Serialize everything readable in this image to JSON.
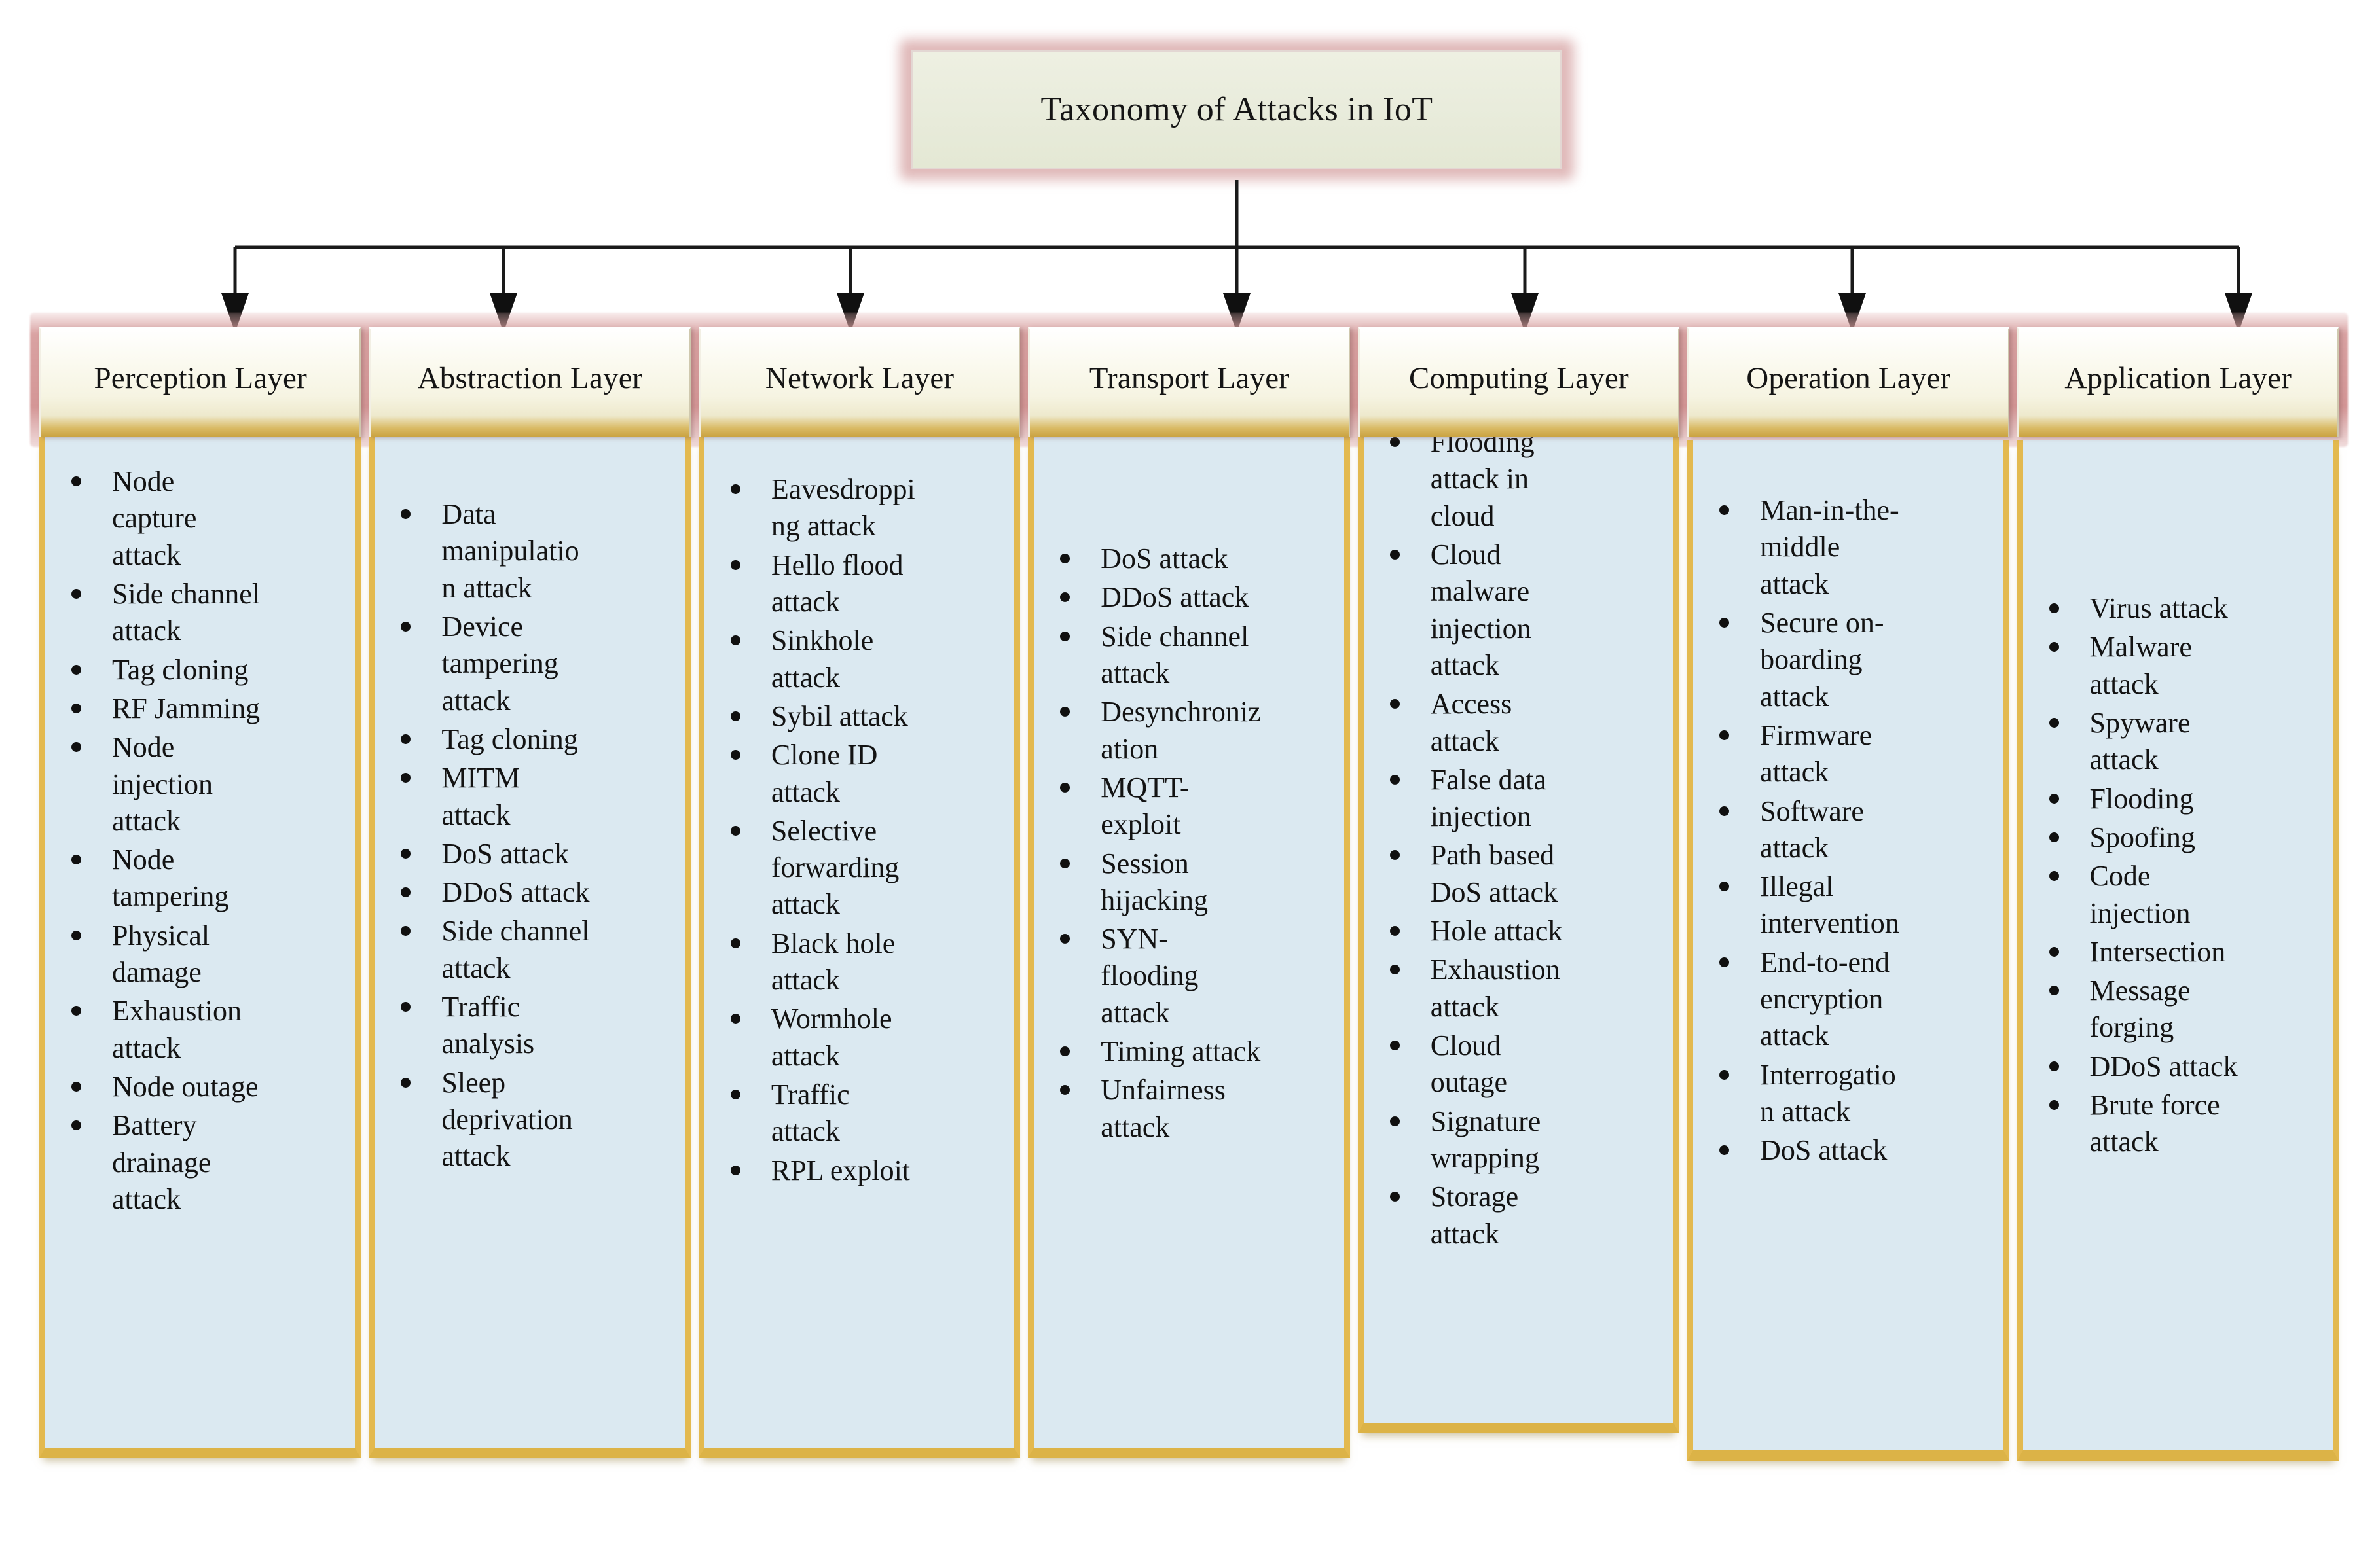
{
  "root": {
    "title": "Taxonomy of Attacks in IoT"
  },
  "colors": {
    "root_fill": "#e9ecdc",
    "root_border": "#e3d7d3",
    "header_band": "#d79d9d",
    "header_fill": "#f6f4e2",
    "header_gold_edge": "#c9a13f",
    "body_fill": "#dbe9f1",
    "body_border_gold": "#e3b94f",
    "text": "#131313",
    "connector": "#1a1a1a"
  },
  "connector": {
    "icon": "down-arrow-icon",
    "count": 7
  },
  "layers": [
    {
      "title": "Perception Layer",
      "attacks": [
        [
          "Node",
          "capture",
          "attack"
        ],
        [
          "Side channel",
          "attack"
        ],
        [
          "Tag cloning"
        ],
        [
          "RF Jamming"
        ],
        [
          "Node",
          "injection",
          "attack"
        ],
        [
          "Node",
          "tampering"
        ],
        [
          "Physical",
          "damage"
        ],
        [
          "Exhaustion",
          "attack"
        ],
        [
          "Node outage"
        ],
        [
          "Battery",
          "drainage",
          "attack"
        ]
      ]
    },
    {
      "title": "Abstraction Layer",
      "attacks": [
        [
          "Data",
          "manipulatio",
          "n attack"
        ],
        [
          "Device",
          "tampering",
          "attack"
        ],
        [
          "Tag cloning"
        ],
        [
          "MITM",
          "attack"
        ],
        [
          "DoS attack"
        ],
        [
          "DDoS attack"
        ],
        [
          "Side channel",
          "attack"
        ],
        [
          "Traffic",
          "analysis"
        ],
        [
          "Sleep",
          "deprivation",
          "attack"
        ]
      ]
    },
    {
      "title": "Network Layer",
      "attacks": [
        [
          "Eavesdroppi",
          "ng attack"
        ],
        [
          "Hello flood",
          "attack"
        ],
        [
          "Sinkhole",
          "attack"
        ],
        [
          "Sybil attack"
        ],
        [
          "Clone ID",
          "attack"
        ],
        [
          "Selective",
          "forwarding",
          "attack"
        ],
        [
          "Black hole",
          "attack"
        ],
        [
          "Wormhole",
          "attack"
        ],
        [
          "Traffic",
          "attack"
        ],
        [
          "RPL  exploit"
        ]
      ]
    },
    {
      "title": "Transport Layer",
      "attacks": [
        [
          "DoS attack"
        ],
        [
          "DDoS attack"
        ],
        [
          "Side channel",
          "attack"
        ],
        [
          "Desynchroniz",
          "ation"
        ],
        [
          "MQTT-",
          "exploit"
        ],
        [
          "Session",
          "hijacking"
        ],
        [
          "SYN-",
          "flooding",
          "attack"
        ],
        [
          "Timing attack"
        ],
        [
          "Unfairness",
          "attack"
        ]
      ]
    },
    {
      "title": "Computing Layer",
      "attacks": [
        [
          "Flooding",
          "attack in",
          "cloud"
        ],
        [
          "Cloud",
          "malware",
          "injection",
          "attack"
        ],
        [
          "Access",
          "attack"
        ],
        [
          "False data",
          "injection"
        ],
        [
          "Path based",
          "DoS attack"
        ],
        [
          "Hole attack"
        ],
        [
          "Exhaustion",
          "attack"
        ],
        [
          "Cloud",
          "outage"
        ],
        [
          "Signature",
          "wrapping"
        ],
        [
          "Storage",
          "attack"
        ]
      ]
    },
    {
      "title": "Operation Layer",
      "attacks": [
        [
          "Man-in-the-",
          "middle",
          "attack"
        ],
        [
          "Secure on-",
          "boarding",
          "attack"
        ],
        [
          "Firmware",
          "attack"
        ],
        [
          "Software",
          "attack"
        ],
        [
          "Illegal",
          "intervention"
        ],
        [
          "End-to-end",
          "encryption",
          "attack"
        ],
        [
          "Interrogatio",
          "n attack"
        ],
        [
          "DoS attack"
        ]
      ]
    },
    {
      "title": "Application Layer",
      "attacks": [
        [
          "Virus attack"
        ],
        [
          "Malware",
          "attack"
        ],
        [
          "Spyware",
          "attack"
        ],
        [
          "Flooding"
        ],
        [
          "Spoofing"
        ],
        [
          "Code",
          "injection"
        ],
        [
          "Intersection"
        ],
        [
          "Message",
          "forging"
        ],
        [
          "DDoS attack"
        ],
        [
          "Brute force",
          "attack"
        ]
      ]
    }
  ]
}
